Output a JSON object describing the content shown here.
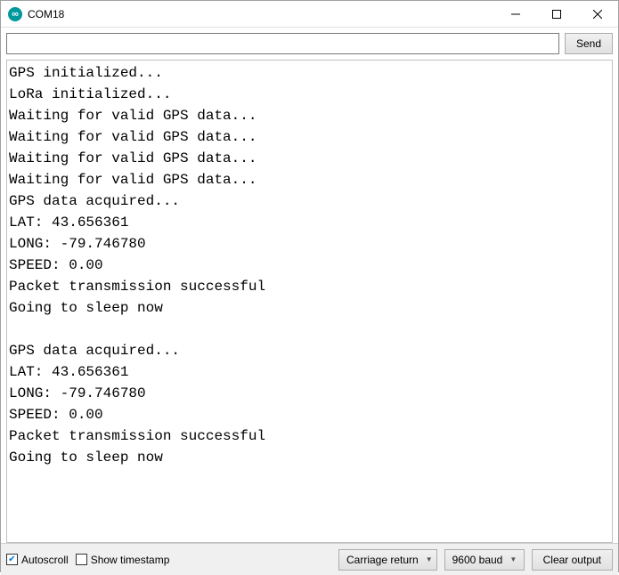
{
  "window": {
    "title": "COM18"
  },
  "input": {
    "value": "",
    "placeholder": ""
  },
  "buttons": {
    "send": "Send",
    "clear": "Clear output"
  },
  "console": {
    "lines": [
      "GPS initialized...",
      "LoRa initialized...",
      "Waiting for valid GPS data...",
      "Waiting for valid GPS data...",
      "Waiting for valid GPS data...",
      "Waiting for valid GPS data...",
      "GPS data acquired...",
      "LAT: 43.656361",
      "LONG: -79.746780",
      "SPEED: 0.00",
      "Packet transmission successful",
      "Going to sleep now",
      "",
      "GPS data acquired...",
      "LAT: 43.656361",
      "LONG: -79.746780",
      "SPEED: 0.00",
      "Packet transmission successful",
      "Going to sleep now"
    ]
  },
  "footer": {
    "autoscroll": {
      "label": "Autoscroll",
      "checked": true
    },
    "timestamp": {
      "label": "Show timestamp",
      "checked": false
    },
    "line_ending": {
      "selected": "Carriage return"
    },
    "baud": {
      "selected": "9600 baud"
    }
  }
}
